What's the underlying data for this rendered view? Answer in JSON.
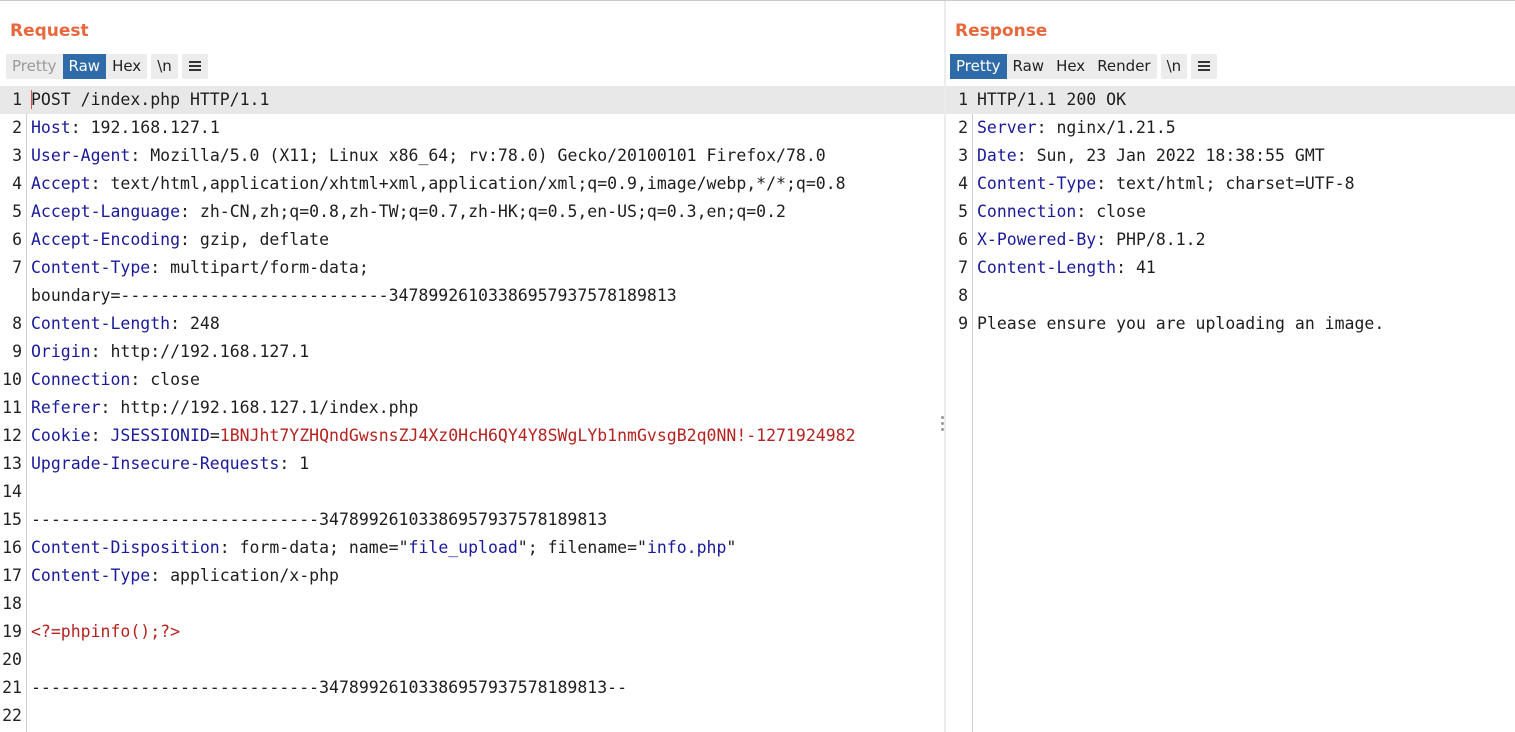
{
  "request": {
    "title": "Request",
    "tabs": {
      "pretty": "Pretty",
      "raw": "Raw",
      "hex": "Hex"
    },
    "newline_toggle": "\\n",
    "lines": [
      {
        "n": "1",
        "plain": "POST /index.php HTTP/1.1"
      },
      {
        "n": "2",
        "name": "Host",
        "sep": ": ",
        "value": "192.168.127.1"
      },
      {
        "n": "3",
        "name": "User-Agent",
        "sep": ": ",
        "value": "Mozilla/5.0 (X11; Linux x86_64; rv:78.0) Gecko/20100101 Firefox/78.0"
      },
      {
        "n": "4",
        "name": "Accept",
        "sep": ": ",
        "value": "text/html,application/xhtml+xml,application/xml;q=0.9,image/webp,*/*;q=0.8"
      },
      {
        "n": "5",
        "name": "Accept-Language",
        "sep": ": ",
        "value": "zh-CN,zh;q=0.8,zh-TW;q=0.7,zh-HK;q=0.5,en-US;q=0.3,en;q=0.2"
      },
      {
        "n": "6",
        "name": "Accept-Encoding",
        "sep": ": ",
        "value": "gzip, deflate"
      },
      {
        "n": "7",
        "name": "Content-Type",
        "sep": ": ",
        "value": "multipart/form-data;",
        "cont": "boundary=---------------------------347899261033869579375781898​13"
      },
      {
        "n": "8",
        "name": "Content-Length",
        "sep": ": ",
        "value": "248"
      },
      {
        "n": "9",
        "name": "Origin",
        "sep": ": ",
        "value": "http://192.168.127.1"
      },
      {
        "n": "10",
        "name": "Connection",
        "sep": ": ",
        "value": "close"
      },
      {
        "n": "11",
        "name": "Referer",
        "sep": ": ",
        "value": "http://192.168.127.1/index.php"
      },
      {
        "n": "12",
        "name": "Cookie",
        "sep": ": ",
        "cookie_key": "JSESSIONID",
        "cookie_eq": "=",
        "cookie_val": "1BNJht7YZHQndGwsnsZJ4Xz0HcH6QY4Y8SWgLYb1nmGvsgB2q0NN!-1271924982"
      },
      {
        "n": "13",
        "name": "Upgrade-Insecure-Requests",
        "sep": ": ",
        "value": "1"
      },
      {
        "n": "14",
        "plain": ""
      },
      {
        "n": "15",
        "plain": "-----------------------------347899261033869579375781898​13"
      },
      {
        "n": "16",
        "name": "Content-Disposition",
        "sep": ": ",
        "value": "form-data; name=\"",
        "q1": "file_upload",
        "mid": "\"; filename=\"",
        "q2": "info.php",
        "end": "\""
      },
      {
        "n": "17",
        "name": "Content-Type",
        "sep": ": ",
        "value": "application/x-php"
      },
      {
        "n": "18",
        "plain": ""
      },
      {
        "n": "19",
        "php": "<?=phpinfo();?>"
      },
      {
        "n": "20",
        "plain": ""
      },
      {
        "n": "21",
        "plain": "-----------------------------347899261033869579375781898​13--"
      },
      {
        "n": "22",
        "plain": ""
      }
    ]
  },
  "response": {
    "title": "Response",
    "tabs": {
      "pretty": "Pretty",
      "raw": "Raw",
      "hex": "Hex",
      "render": "Render"
    },
    "newline_toggle": "\\n",
    "lines": [
      {
        "n": "1",
        "plain": "HTTP/1.1 200 OK"
      },
      {
        "n": "2",
        "name": "Server",
        "sep": ": ",
        "value": "nginx/1.21.5"
      },
      {
        "n": "3",
        "name": "Date",
        "sep": ": ",
        "value": "Sun, 23 Jan 2022 18:38:55 GMT"
      },
      {
        "n": "4",
        "name": "Content-Type",
        "sep": ": ",
        "value": "text/html; charset=UTF-8"
      },
      {
        "n": "5",
        "name": "Connection",
        "sep": ": ",
        "value": "close"
      },
      {
        "n": "6",
        "name": "X-Powered-By",
        "sep": ": ",
        "value": "PHP/8.1.2"
      },
      {
        "n": "7",
        "name": "Content-Length",
        "sep": ": ",
        "value": "41"
      },
      {
        "n": "8",
        "plain": ""
      },
      {
        "n": "9",
        "plain": "Please ensure you are uploading an image."
      }
    ]
  }
}
